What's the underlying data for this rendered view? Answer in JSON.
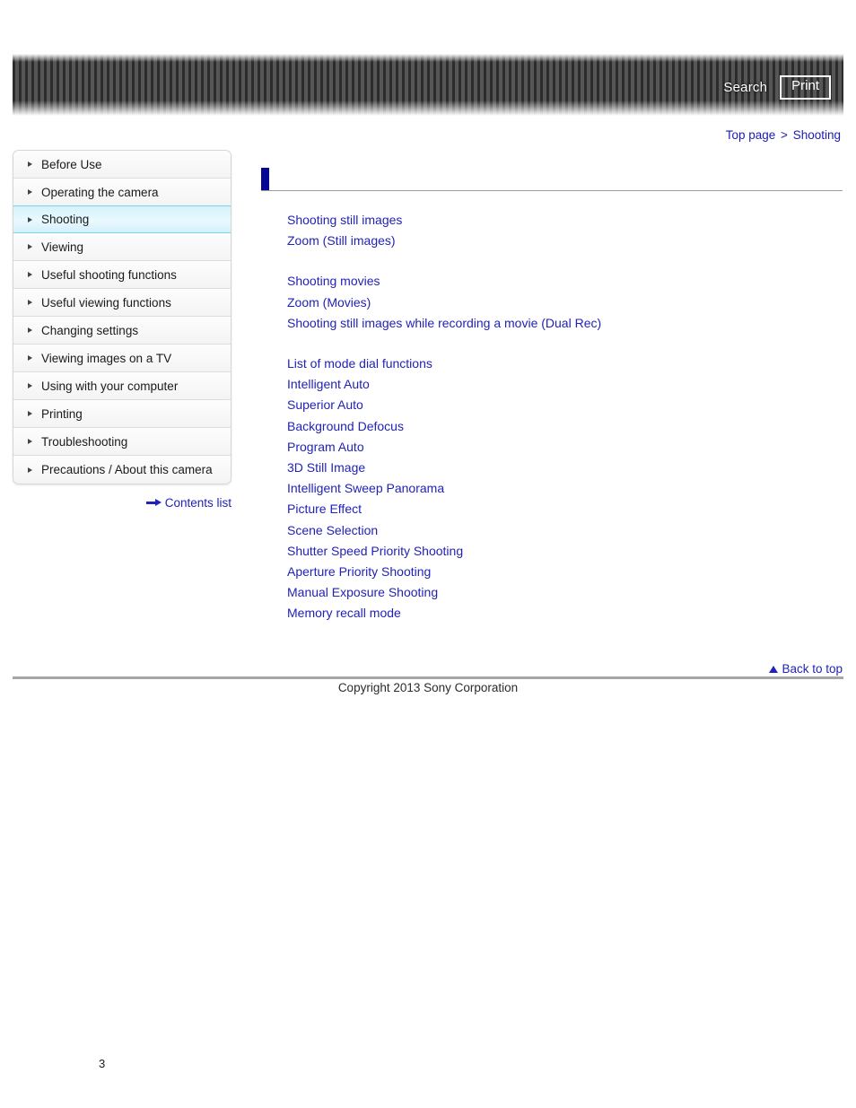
{
  "header": {
    "search_label": "Search",
    "print_label": "Print",
    "search_icon": "search-icon",
    "print_icon": "printer-icon"
  },
  "breadcrumb": {
    "top_page": "Top page",
    "separator": ">",
    "current": "Shooting"
  },
  "sidebar": {
    "items": [
      {
        "label": "Before Use",
        "active": false
      },
      {
        "label": "Operating the camera",
        "active": false
      },
      {
        "label": "Shooting",
        "active": true
      },
      {
        "label": "Viewing",
        "active": false
      },
      {
        "label": "Useful shooting functions",
        "active": false
      },
      {
        "label": "Useful viewing functions",
        "active": false
      },
      {
        "label": "Changing settings",
        "active": false
      },
      {
        "label": "Viewing images on a TV",
        "active": false
      },
      {
        "label": "Using with your computer",
        "active": false
      },
      {
        "label": "Printing",
        "active": false
      },
      {
        "label": "Troubleshooting",
        "active": false
      },
      {
        "label": "Precautions / About this camera",
        "active": false
      }
    ],
    "contents_list_label": "Contents list",
    "contents_list_icon": "arrow-right-icon"
  },
  "main": {
    "page_title": "",
    "groups": [
      {
        "links": [
          "Shooting still images",
          "Zoom (Still images)"
        ]
      },
      {
        "links": [
          "Shooting movies",
          "Zoom (Movies)",
          "Shooting still images while recording a movie (Dual Rec)"
        ]
      },
      {
        "links": [
          "List of mode dial functions",
          "Intelligent Auto",
          "Superior Auto",
          "Background Defocus",
          "Program Auto",
          "3D Still Image",
          "Intelligent Sweep Panorama",
          "Picture Effect",
          "Scene Selection",
          "Shutter Speed Priority Shooting",
          "Aperture Priority Shooting",
          "Manual Exposure Shooting",
          "Memory recall mode"
        ]
      }
    ]
  },
  "footer": {
    "back_to_top_label": "Back to top",
    "back_to_top_icon": "triangle-up-icon",
    "copyright": "Copyright 2013 Sony Corporation",
    "page_number": "3"
  },
  "colors": {
    "link_blue": "#2222b8",
    "title_blue": "#060695",
    "active_nav": "#d4f2fb",
    "banner_dark": "#2c2c2c",
    "banner_light": "#565656"
  }
}
